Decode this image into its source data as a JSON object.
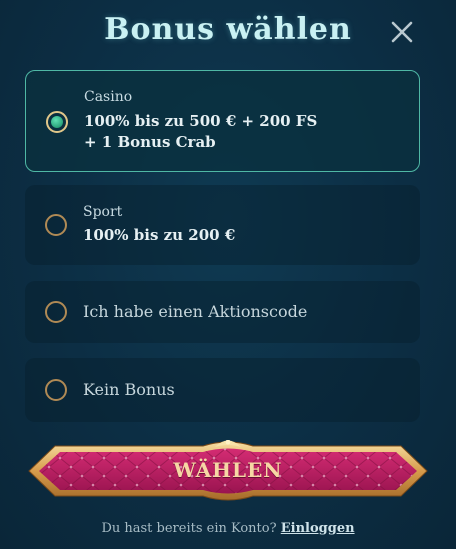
{
  "modal": {
    "title": "Bonus wählen",
    "close_icon": "close-icon"
  },
  "options": [
    {
      "label": "Casino",
      "main_line1": "100% bis zu 500 € + 200 FS",
      "main_line2": "+ 1 Bonus Crab",
      "selected": true
    },
    {
      "label": "Sport",
      "main_line1": "100% bis zu 200 €",
      "selected": false
    },
    {
      "text": "Ich habe einen Aktionscode",
      "selected": false
    },
    {
      "text": "Kein Bonus",
      "selected": false
    }
  ],
  "submit": {
    "label": "WÄHLEN"
  },
  "footer": {
    "prompt": "Du hast bereits ein Konto?",
    "link": "Einloggen"
  },
  "colors": {
    "background": "#0c2e44",
    "selected_border": "#4fb8a5",
    "radio_selected": "#2aa27a",
    "button_fill": "#b01a5c",
    "button_frame": "#e3b56e",
    "title": "#c9f1f3"
  }
}
